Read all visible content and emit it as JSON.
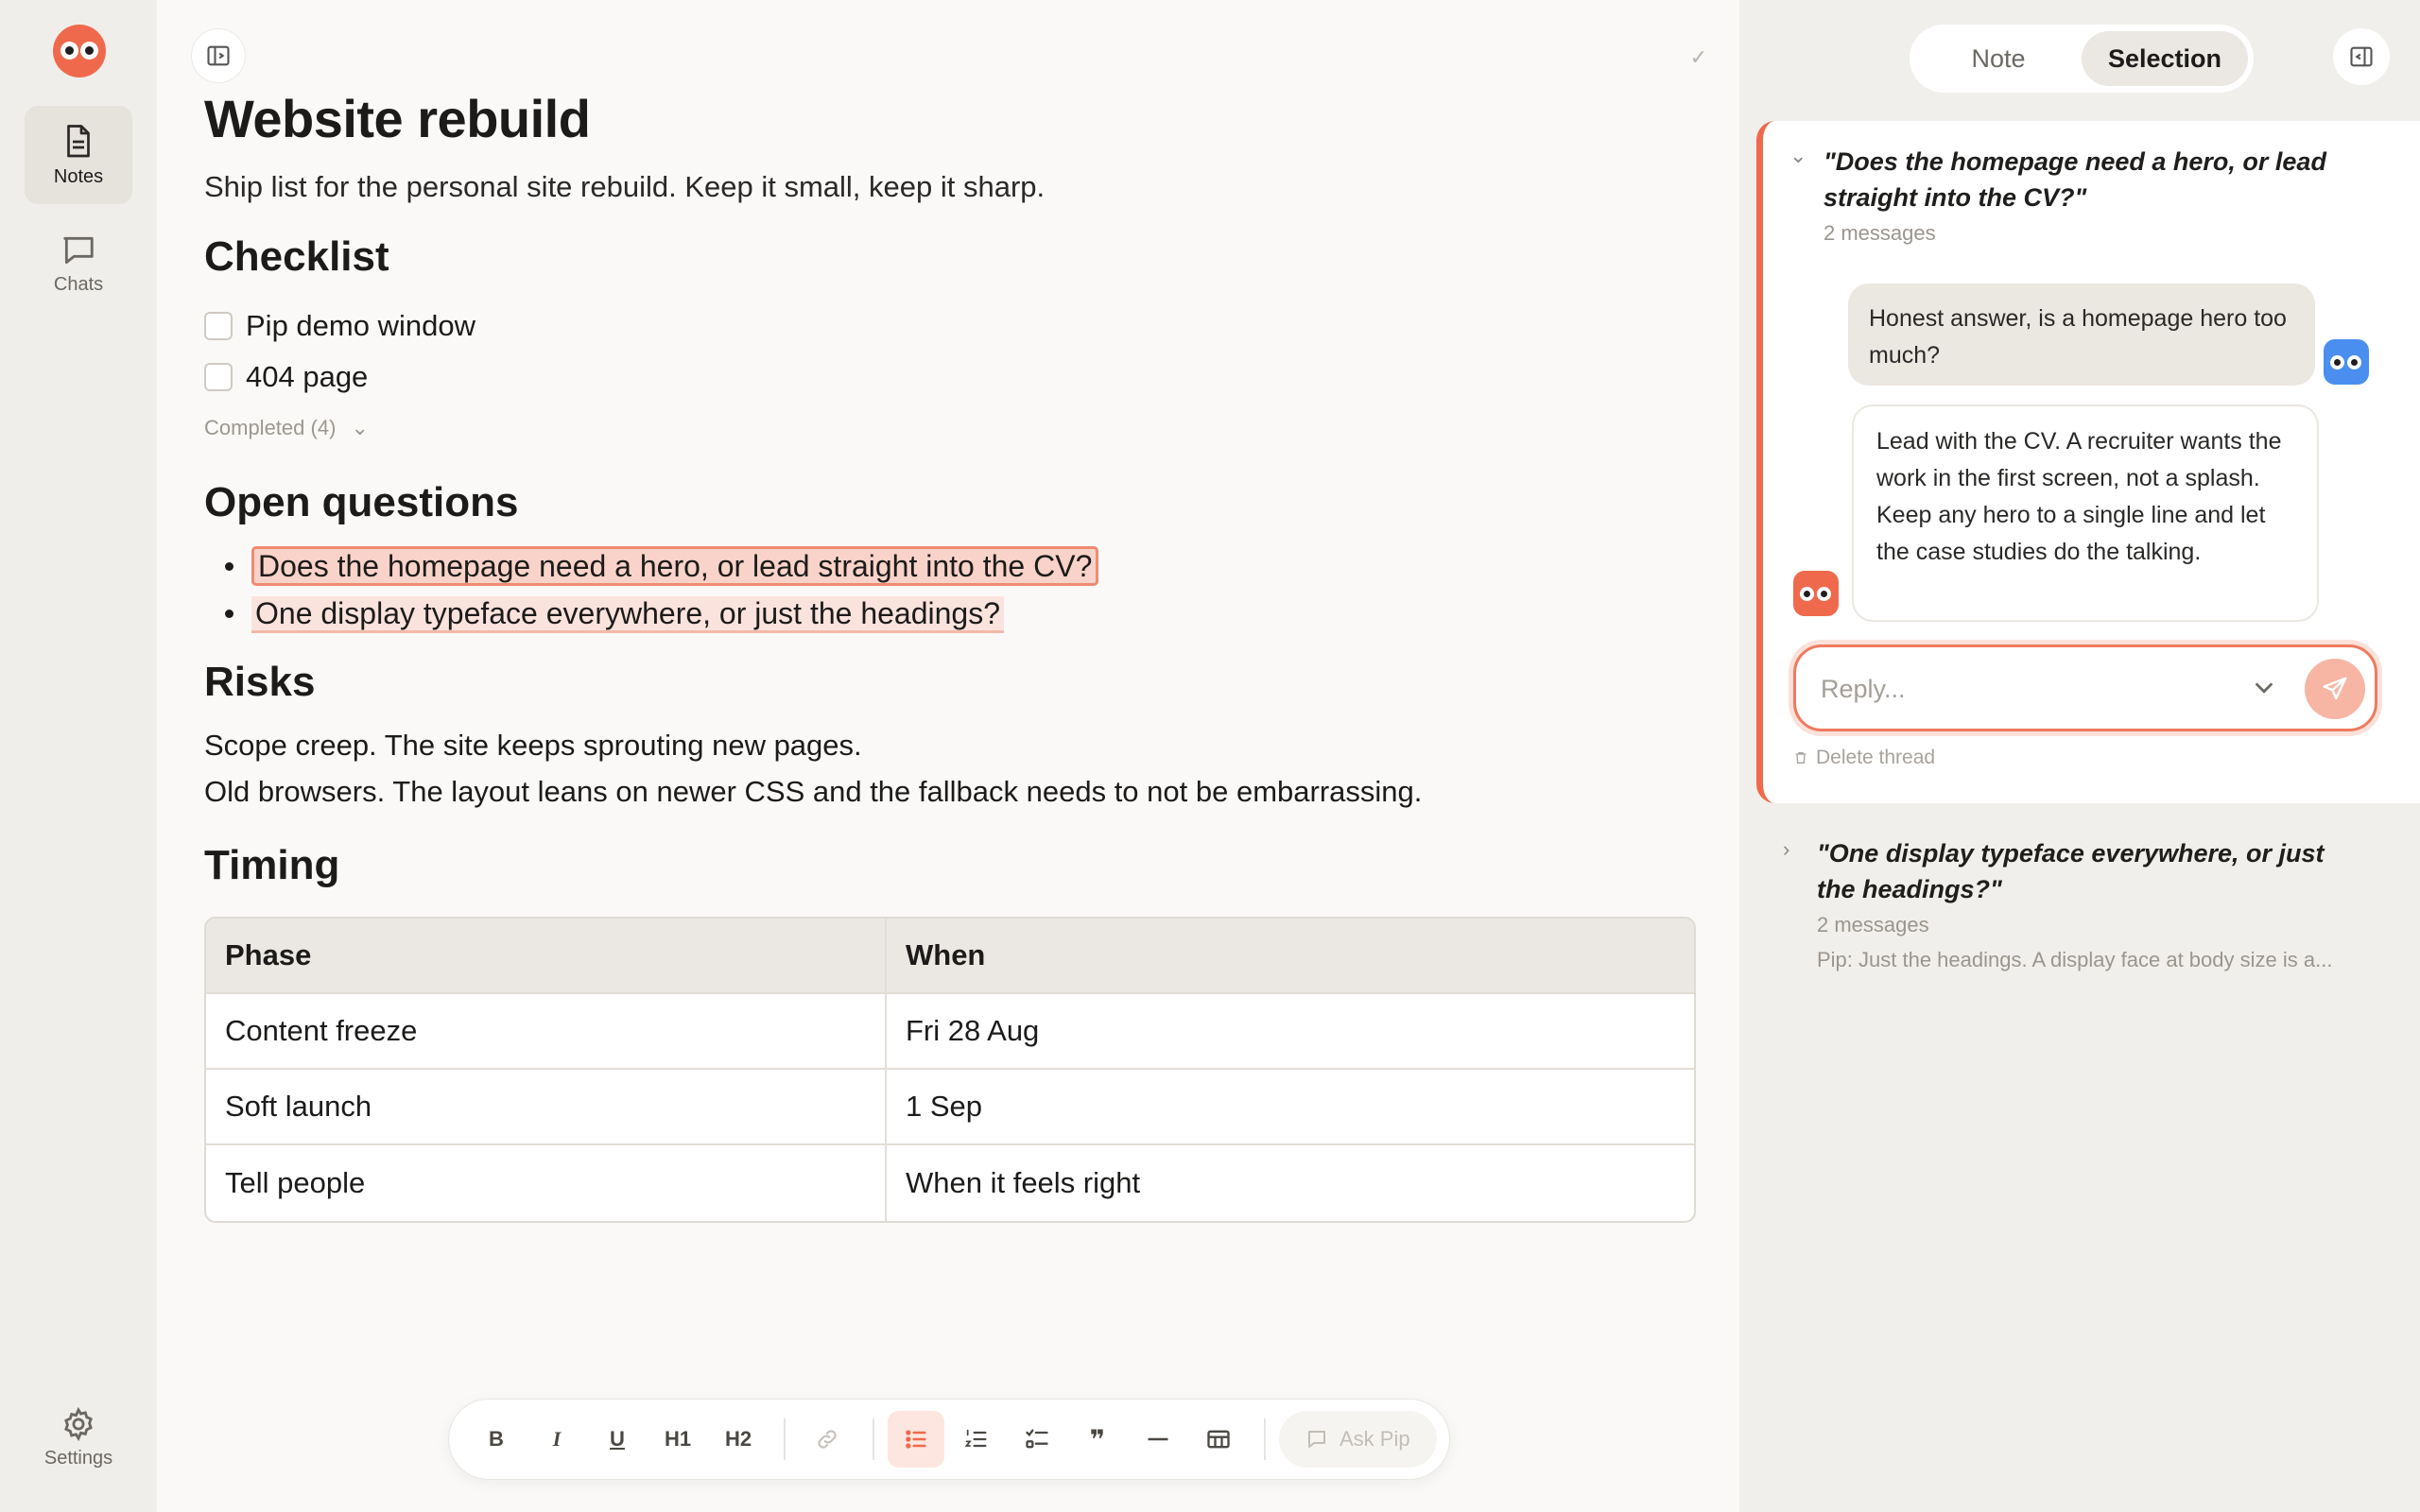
{
  "rail": {
    "items": [
      {
        "label": "Notes",
        "icon": "notes-icon",
        "active": true
      },
      {
        "label": "Chats",
        "icon": "chats-icon",
        "active": false
      }
    ],
    "settings_label": "Settings"
  },
  "doc": {
    "title": "Website rebuild",
    "subtitle": "Ship list for the personal site rebuild. Keep it small, keep it sharp.",
    "checklist_heading": "Checklist",
    "checklist": [
      "Pip demo window",
      "404 page"
    ],
    "completed_label": "Completed (4)",
    "questions_heading": "Open questions",
    "questions": [
      "Does the homepage need a hero, or lead straight into the CV?",
      "One display typeface everywhere, or just the headings?"
    ],
    "risks_heading": "Risks",
    "risks": [
      "Scope creep. The site keeps sprouting new pages.",
      "Old browsers. The layout leans on newer CSS and the fallback needs to not be embarrassing."
    ],
    "timing_heading": "Timing",
    "table": {
      "headers": [
        "Phase",
        "When"
      ],
      "rows": [
        [
          "Content freeze",
          "Fri 28 Aug"
        ],
        [
          "Soft launch",
          "1 Sep"
        ],
        [
          "Tell people",
          "When it feels right"
        ]
      ]
    }
  },
  "toolbar": {
    "bold": "B",
    "italic": "I",
    "underline": "U",
    "h1": "H1",
    "h2": "H2",
    "ask_pip": "Ask Pip"
  },
  "panel": {
    "tabs": [
      "Note",
      "Selection"
    ],
    "active_tab": "Selection",
    "threads": [
      {
        "quote": "\"Does the homepage need a hero, or lead straight into the CV?\"",
        "count": "2 messages",
        "user_message": "Honest answer, is a homepage hero too much?",
        "pip_message": "Lead with the CV. A recruiter wants the work in the first screen, not a splash. Keep any hero to a single line and let the case studies do the talking.",
        "reply_placeholder": "Reply...",
        "delete_label": "Delete thread"
      },
      {
        "quote": "\"One display typeface everywhere, or just the headings?\"",
        "count": "2 messages",
        "preview": "Pip: Just the headings. A display face at body size is a..."
      }
    ]
  },
  "colors": {
    "accent": "#ef6a4c",
    "user_avatar": "#4a8ff0",
    "highlight": "#fbe3dd"
  }
}
